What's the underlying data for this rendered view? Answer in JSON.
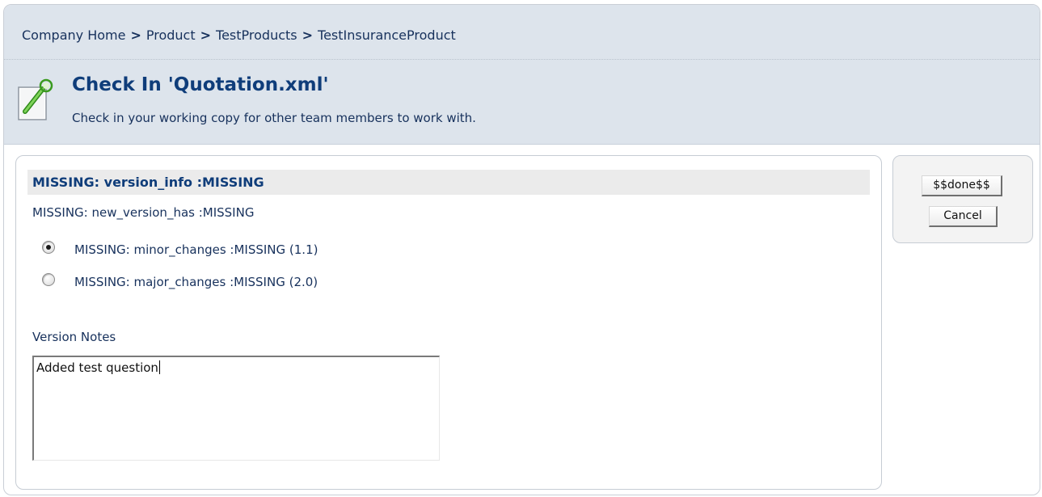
{
  "breadcrumb": {
    "items": [
      "Company Home",
      "Product",
      "TestProducts",
      "TestInsuranceProduct"
    ],
    "separator": ">"
  },
  "header": {
    "title": "Check In 'Quotation.xml'",
    "subtitle": "Check in your working copy for other team members to work with.",
    "icon": "checkin-wand-icon"
  },
  "form": {
    "section_title": "MISSING: version_info :MISSING",
    "new_version_label": "MISSING: new_version_has :MISSING",
    "options": [
      {
        "label": "MISSING: minor_changes :MISSING (1.1)",
        "checked": true
      },
      {
        "label": "MISSING: major_changes :MISSING (2.0)",
        "checked": false
      }
    ],
    "notes_label": "Version Notes",
    "notes_value": "Added test question"
  },
  "actions": {
    "done_label": "$$done$$",
    "cancel_label": "Cancel"
  },
  "colors": {
    "header_bg": "#dde4ec",
    "title": "#0f3d7a",
    "text": "#17315c",
    "section_bg": "#ebebeb"
  }
}
